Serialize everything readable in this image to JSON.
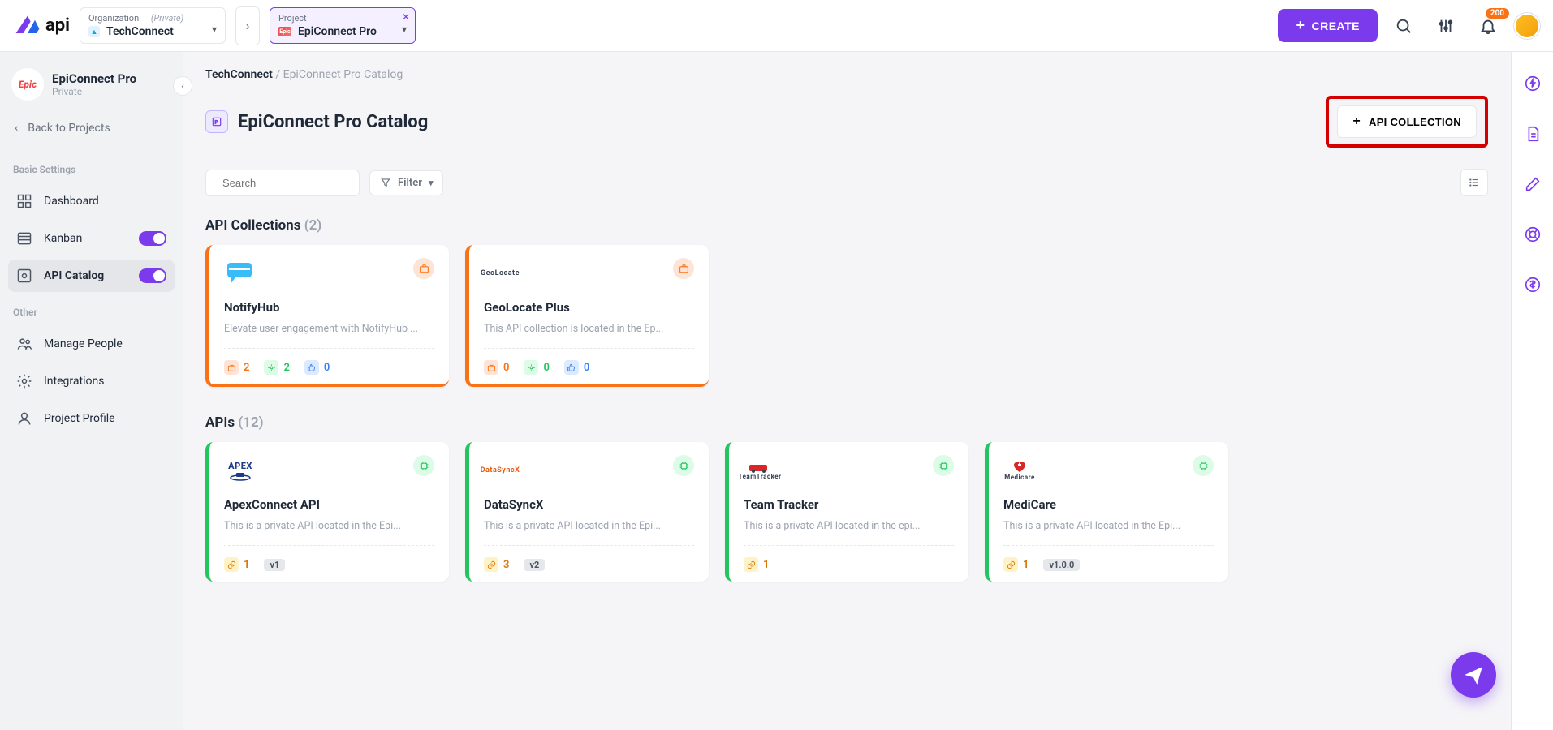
{
  "topbar": {
    "org_label": "Organization",
    "org_privacy": "(Private)",
    "org_value": "TechConnect",
    "project_label": "Project",
    "project_value": "EpiConnect Pro",
    "create_label": "CREATE",
    "notif_count": "200"
  },
  "sidebar": {
    "project_title": "EpiConnect Pro",
    "project_sub": "Private",
    "back_label": "Back to Projects",
    "section_basic": "Basic Settings",
    "section_other": "Other",
    "items": {
      "dashboard": "Dashboard",
      "kanban": "Kanban",
      "api_catalog": "API Catalog",
      "manage_people": "Manage People",
      "integrations": "Integrations",
      "project_profile": "Project Profile"
    }
  },
  "crumbs": {
    "org": "TechConnect",
    "sep": " / ",
    "page": "EpiConnect Pro Catalog"
  },
  "page_title": "EpiConnect Pro Catalog",
  "api_collection_btn": "API COLLECTION",
  "search_placeholder": "Search",
  "filter_label": "Filter",
  "collections": {
    "title": "API Collections",
    "count": "(2)",
    "items": [
      {
        "name": "NotifyHub",
        "desc": "Elevate user engagement with NotifyHub ...",
        "s1": "2",
        "s2": "2",
        "s3": "0",
        "logo_style": "svg"
      },
      {
        "name": "GeoLocate Plus",
        "desc": "This API collection is located in the Ep...",
        "s1": "0",
        "s2": "0",
        "s3": "0",
        "logo_style": "txt",
        "logo_text": "GeoLocate"
      }
    ]
  },
  "apis": {
    "title": "APIs",
    "count": "(12)",
    "items": [
      {
        "name": "ApexConnect API",
        "desc": "This is a private API located in the Epi...",
        "link_count": "1",
        "version": "v1",
        "logo_text": "APEX"
      },
      {
        "name": "DataSyncX",
        "desc": "This is a private API located in the Epi...",
        "link_count": "3",
        "version": "v2",
        "logo_text": "DataSyncX"
      },
      {
        "name": "Team Tracker",
        "desc": "This is a private API located in the epi...",
        "link_count": "1",
        "version": "",
        "logo_text": "TeamTracker"
      },
      {
        "name": "MediCare",
        "desc": "This is a private API located in the Epi...",
        "link_count": "1",
        "version": "v1.0.0",
        "logo_text": "Medicare"
      }
    ]
  }
}
